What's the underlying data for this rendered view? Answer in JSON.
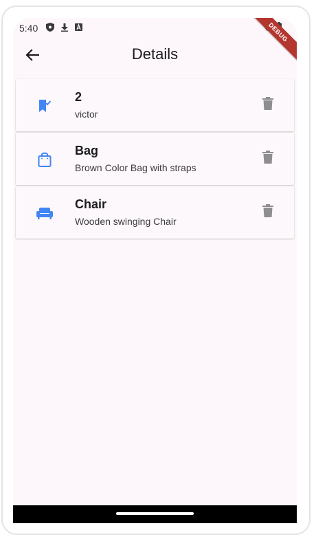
{
  "status_bar": {
    "time": "5:40",
    "icons": [
      "shield-icon",
      "download-icon",
      "a-icon",
      "wifi-icon",
      "battery-icon"
    ]
  },
  "debug_banner": "DEBUG",
  "app_bar": {
    "title": "Details",
    "back_icon": "arrow-left-icon"
  },
  "items": [
    {
      "title": "2",
      "subtitle": "victor",
      "icon": "bookmark-added-icon",
      "delete_icon": "trash-icon"
    },
    {
      "title": "Bag",
      "subtitle": "Brown Color Bag with straps",
      "icon": "shopping-bag-icon",
      "delete_icon": "trash-icon"
    },
    {
      "title": "Chair",
      "subtitle": "Wooden swinging Chair",
      "icon": "armchair-icon",
      "delete_icon": "trash-icon"
    }
  ],
  "colors": {
    "accent": "#4285f4",
    "delete_icon": "#8e8e8e",
    "background": "#fdf7fb",
    "debug_ribbon": "#b3372f"
  }
}
